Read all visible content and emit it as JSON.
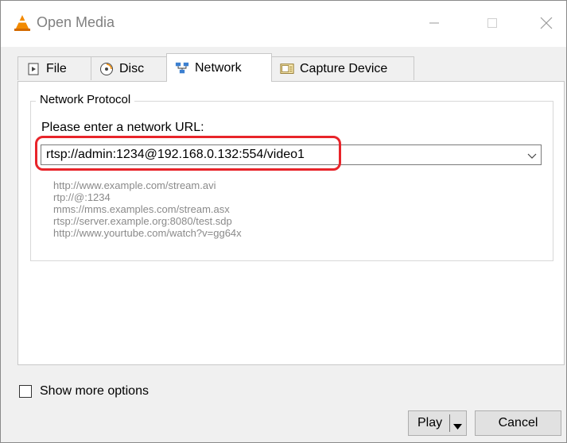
{
  "window": {
    "title": "Open Media",
    "icon": "vlc-cone-icon"
  },
  "tabs": [
    {
      "label": "File",
      "icon": "file-play-icon",
      "selected": false
    },
    {
      "label": "Disc",
      "icon": "disc-icon",
      "selected": false
    },
    {
      "label": "Network",
      "icon": "network-icon",
      "selected": true
    },
    {
      "label": "Capture Device",
      "icon": "capture-device-icon",
      "selected": false
    }
  ],
  "network": {
    "group_label": "Network Protocol",
    "prompt": "Please enter a network URL:",
    "url_value": "rtsp://admin:1234@192.168.0.132:554/video1",
    "examples": [
      "http://www.example.com/stream.avi",
      "rtp://@:1234",
      "mms://mms.examples.com/stream.asx",
      "rtsp://server.example.org:8080/test.sdp",
      "http://www.yourtube.com/watch?v=gg64x"
    ]
  },
  "options": {
    "show_more_label": "Show more options",
    "checked": false
  },
  "buttons": {
    "play_label": "Play",
    "cancel_label": "Cancel"
  },
  "colors": {
    "highlight": "#e8242a",
    "vlc_orange": "#f28a00"
  }
}
